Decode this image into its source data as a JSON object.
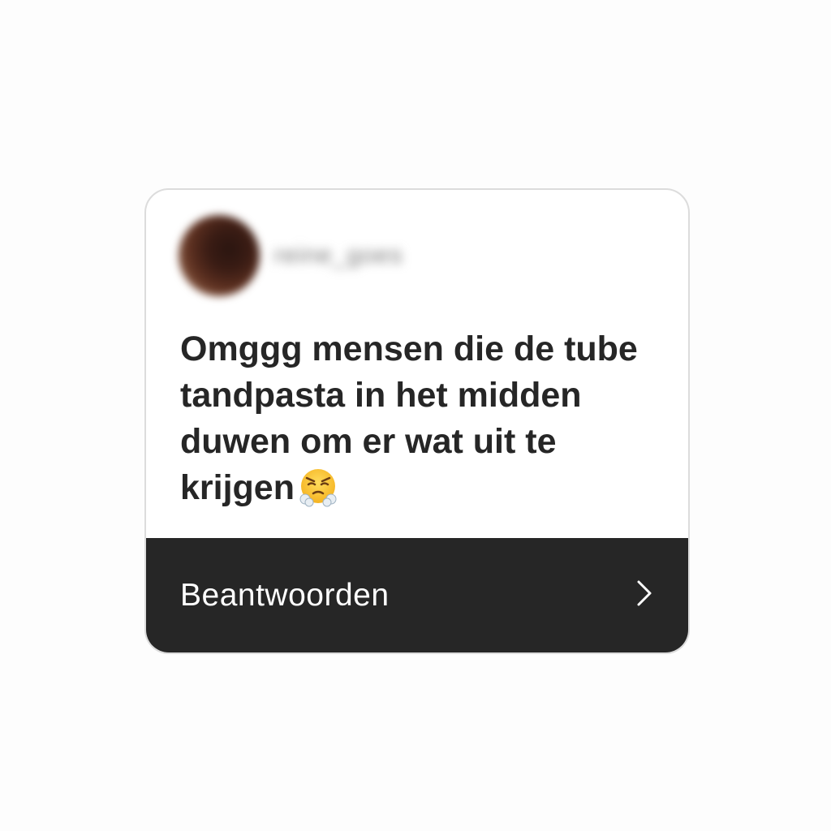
{
  "card": {
    "username": "reine_goes",
    "question": "Omggg mensen die de tube tandpasta in het midden duwen om er wat uit te krijgen",
    "emoji": "face-with-steam-from-nose",
    "reply_label": "Beantwoorden",
    "chevron": "chevron-right-icon"
  },
  "colors": {
    "card_bg": "#ffffff",
    "reply_bar_bg": "#262626",
    "text_dark": "#262626",
    "text_light": "#ffffff",
    "border": "#dcdcdc"
  }
}
